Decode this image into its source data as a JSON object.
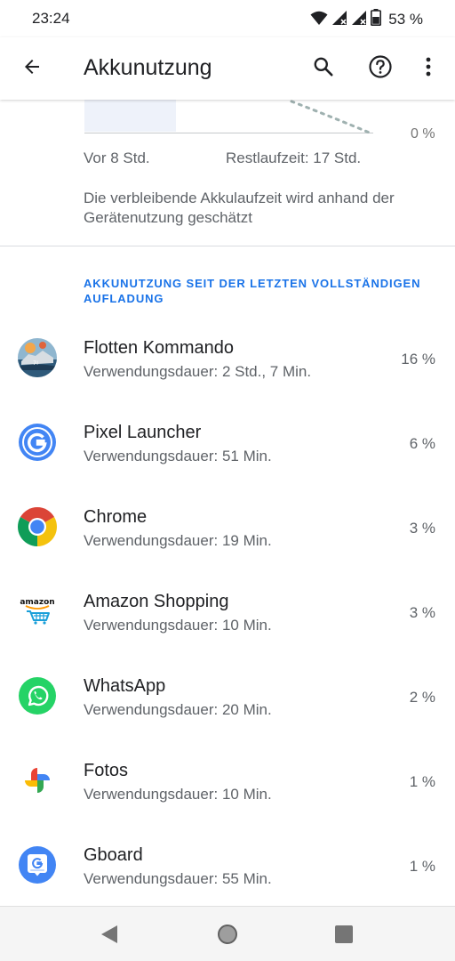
{
  "status_bar": {
    "time": "23:24",
    "battery_text": "53 %",
    "icons": [
      "wifi-icon",
      "signal-icon",
      "signal-icon",
      "battery-icon"
    ]
  },
  "app_bar": {
    "title": "Akkunutzung",
    "icons": [
      "back-arrow-icon",
      "search-icon",
      "help-icon",
      "more-vert-icon"
    ]
  },
  "graph": {
    "zero_label": "0 %",
    "left_label": "Vor 8 Std.",
    "right_label": "Restlaufzeit: 17 Std.",
    "note": "Die verbleibende Akkulaufzeit wird anhand der Gerätenutzung geschätzt"
  },
  "section_header": "AKKUNUTZUNG SEIT DER LETZTEN VOLLSTÄNDIGEN AUFLADUNG",
  "apps": [
    {
      "name": "Flotten Kommando",
      "usage": "Verwendungsdauer: 2 Std., 7 Min.",
      "percent": "16 %",
      "icon": "flotten-kommando-icon"
    },
    {
      "name": "Pixel Launcher",
      "usage": "Verwendungsdauer: 51 Min.",
      "percent": "6 %",
      "icon": "google-g-icon"
    },
    {
      "name": "Chrome",
      "usage": "Verwendungsdauer: 19 Min.",
      "percent": "3 %",
      "icon": "chrome-icon"
    },
    {
      "name": "Amazon Shopping",
      "usage": "Verwendungsdauer: 10 Min.",
      "percent": "3 %",
      "icon": "amazon-icon"
    },
    {
      "name": "WhatsApp",
      "usage": "Verwendungsdauer: 20 Min.",
      "percent": "2 %",
      "icon": "whatsapp-icon"
    },
    {
      "name": "Fotos",
      "usage": "Verwendungsdauer: 10 Min.",
      "percent": "1 %",
      "icon": "photos-pinwheel-icon"
    },
    {
      "name": "Gboard",
      "usage": "Verwendungsdauer: 55 Min.",
      "percent": "1 %",
      "icon": "gboard-icon"
    }
  ],
  "amazon_logo_text": "amazon",
  "nav_bar": {
    "icons": [
      "nav-back-icon",
      "nav-home-icon",
      "nav-recents-icon"
    ]
  },
  "colors": {
    "accent": "#1a73e8",
    "text_primary": "#202124",
    "text_secondary": "#5f6368"
  }
}
